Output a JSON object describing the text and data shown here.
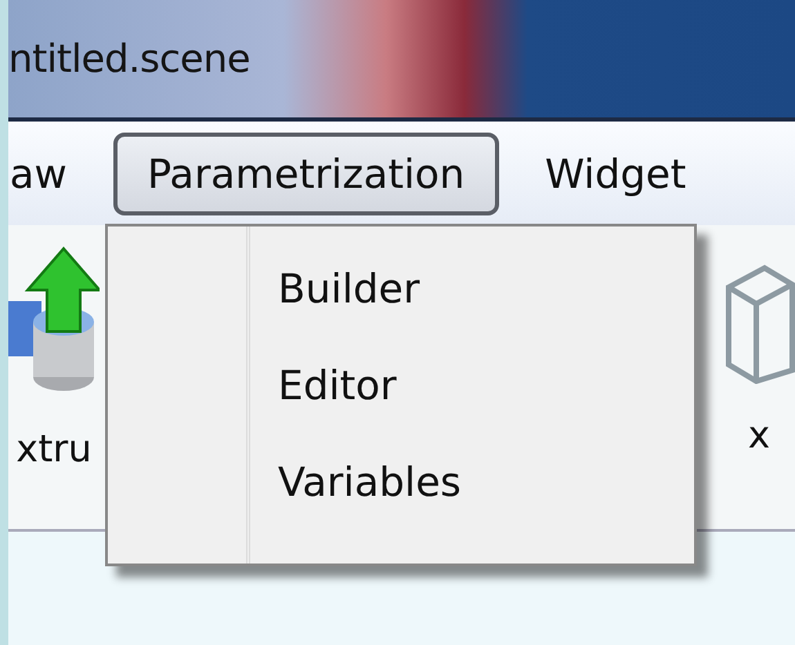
{
  "window": {
    "title": "ntitled.scene"
  },
  "menu_bar": [
    {
      "label": "aw",
      "selected": false
    },
    {
      "label": "Parametrization",
      "selected": true
    },
    {
      "label": "Widget",
      "selected": false
    }
  ],
  "toolbar": [
    {
      "label": "xtru",
      "kind": "extrude"
    },
    {
      "label": "x",
      "kind": "box"
    }
  ],
  "dropdown": {
    "items": [
      "Builder",
      "Editor",
      "Variables"
    ]
  }
}
